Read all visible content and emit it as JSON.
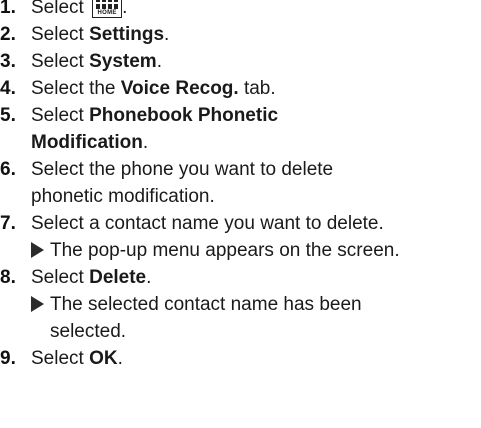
{
  "steps": [
    {
      "number": "1.",
      "prefix": "Select ",
      "icon": "home-icon",
      "icon_label": "HOME",
      "suffix": "."
    },
    {
      "number": "2.",
      "prefix": "Select ",
      "bold": "Settings",
      "suffix": "."
    },
    {
      "number": "3.",
      "prefix": "Select ",
      "bold": "System",
      "suffix": "."
    },
    {
      "number": "4.",
      "prefix": "Select the ",
      "bold": "Voice Recog.",
      "suffix": " tab."
    },
    {
      "number": "5.",
      "prefix": "Select ",
      "bold": "Phonebook Phonetic",
      "bold_cont": "Modification",
      "suffix": "."
    },
    {
      "number": "6.",
      "line1": "Select the phone you want to delete",
      "line2": "phonetic modification."
    },
    {
      "number": "7.",
      "line1": "Select a contact name you want to delete.",
      "result": "The pop-up menu appears on the screen."
    },
    {
      "number": "8.",
      "prefix": "Select ",
      "bold": "Delete",
      "suffix": ".",
      "result": "The selected contact name has been",
      "result_cont": "selected."
    },
    {
      "number": "9.",
      "prefix": "Select ",
      "bold": "OK",
      "suffix": "."
    }
  ]
}
